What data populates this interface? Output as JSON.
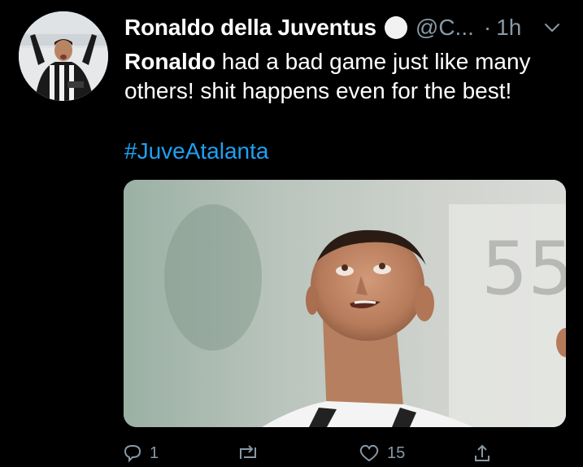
{
  "tweet": {
    "display_name": "Ronaldo della Juventus",
    "handle": "@C...",
    "separator": "·",
    "time": "1h",
    "body_bold": "Ronaldo",
    "body_rest": " had a bad game just like many others! shit happens even for the best!",
    "hashtag": "#JuveAtalanta",
    "avatar_icon": "avatar-photo",
    "verified_badge_icon": "white-circle-emoji",
    "menu_icon": "chevron-down-icon",
    "media_icon": "photo-player-looking-up"
  },
  "actions": {
    "reply_count": "1",
    "retweet_count": "",
    "like_count": "15"
  },
  "colors": {
    "background": "#000000",
    "text": "#ffffff",
    "secondary": "#8899a6",
    "link": "#1da1f2"
  }
}
